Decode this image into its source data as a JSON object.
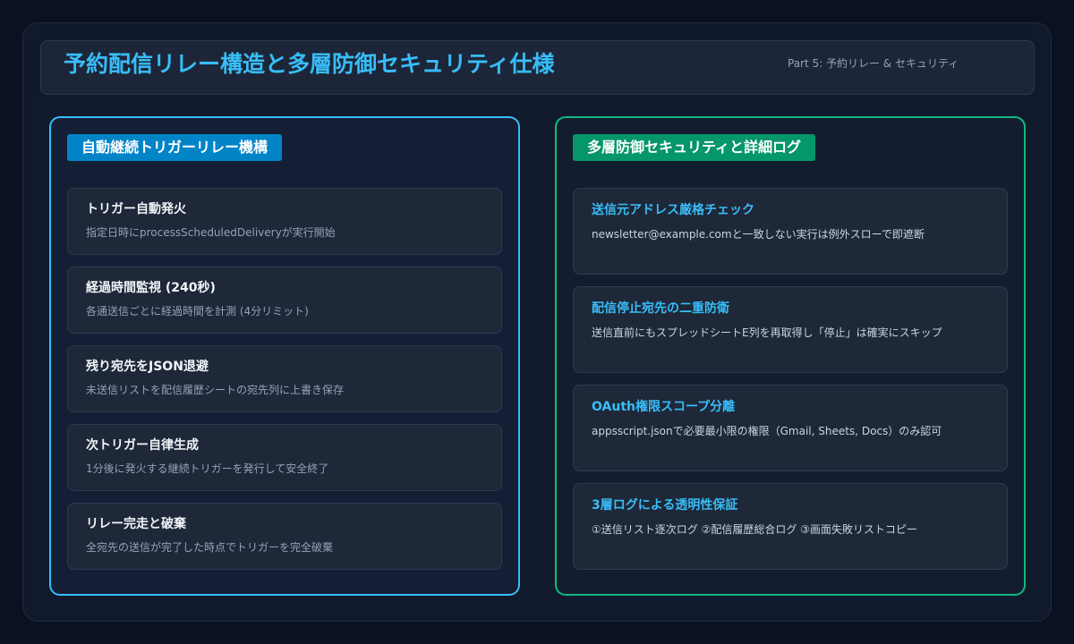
{
  "header": {
    "title": "予約配信リレー構造と多層防御セキュリティ仕様",
    "subtitle": "Part 5: 予約リレー & セキュリティ"
  },
  "colors": {
    "accent_blue": "#38bdf8",
    "accent_green": "#10b981",
    "tag_blue": "#0284c7",
    "tag_green": "#059669",
    "background": "#0b1120"
  },
  "left_panel": {
    "heading": "自動継続トリガーリレー機構",
    "items": [
      {
        "title": "トリガー自動発火",
        "desc": "指定日時にprocessScheduledDeliveryが実行開始"
      },
      {
        "title": "経過時間監視 (240秒)",
        "desc": "各通送信ごとに経過時間を計測 (4分リミット)"
      },
      {
        "title": "残り宛先をJSON退避",
        "desc": "未送信リストを配信履歴シートの宛先列に上書き保存"
      },
      {
        "title": "次トリガー自律生成",
        "desc": "1分後に発火する継続トリガーを発行して安全終了"
      },
      {
        "title": "リレー完走と破棄",
        "desc": "全宛先の送信が完了した時点でトリガーを完全破棄"
      }
    ]
  },
  "right_panel": {
    "heading": "多層防御セキュリティと詳細ログ",
    "items": [
      {
        "title": "送信元アドレス厳格チェック",
        "desc": "newsletter@example.comと一致しない実行は例外スローで即遮断"
      },
      {
        "title": "配信停止宛先の二重防衛",
        "desc": "送信直前にもスプレッドシートE列を再取得し「停止」は確実にスキップ"
      },
      {
        "title": "OAuth権限スコープ分離",
        "desc": "appsscript.jsonで必要最小限の権限（Gmail, Sheets, Docs）のみ認可"
      },
      {
        "title": "3層ログによる透明性保証",
        "desc": "①送信リスト逐次ログ ②配信履歴総合ログ ③画面失敗リストコピー"
      }
    ]
  }
}
